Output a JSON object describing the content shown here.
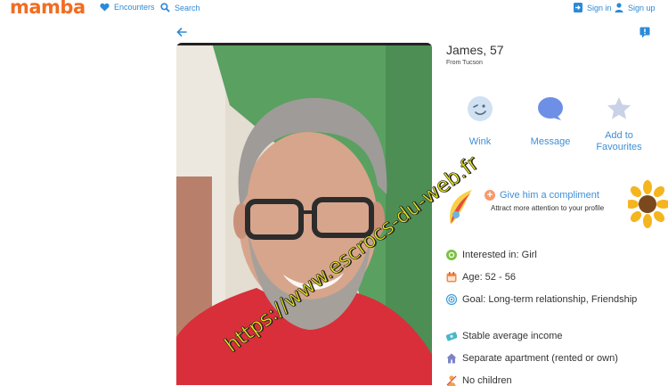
{
  "header": {
    "logo": "mamba",
    "nav": [
      {
        "label": "Encounters",
        "icon": "heart-icon"
      },
      {
        "label": "Search",
        "icon": "search-icon"
      }
    ],
    "signin_label": "Sign in",
    "signup_label": "Sign up"
  },
  "photo": {
    "watermark": "https://www.escrocs-du-web.fr"
  },
  "profile": {
    "name": "James, 57",
    "location": "From Tucson"
  },
  "actions": [
    {
      "label": "Wink",
      "icon": "wink-icon"
    },
    {
      "label": "Message",
      "icon": "message-icon"
    },
    {
      "label": "Add to Favourites",
      "icon": "star-icon"
    }
  ],
  "compliment": {
    "title": "Give him a compliment",
    "subtitle": "Attract more attention to your profile",
    "plus": "+"
  },
  "details": [
    {
      "text": "Interested in: Girl",
      "icon": "gender-icon",
      "color": "#7bc043"
    },
    {
      "text": "Age: 52 - 56",
      "icon": "calendar-icon",
      "color": "#f28b48"
    },
    {
      "text": "Goal: Long-term relationship, Friendship",
      "icon": "target-icon",
      "color": "#3b9dd9"
    },
    {
      "text": "Stable average income",
      "icon": "money-icon",
      "color": "#4ab7c7"
    },
    {
      "text": "Separate apartment (rented or own)",
      "icon": "house-icon",
      "color": "#7b84c8"
    },
    {
      "text": "No children",
      "icon": "child-icon",
      "color": "#f2a34a"
    }
  ],
  "colors": {
    "brand": "#f26c21",
    "link": "#2d8ad6"
  }
}
